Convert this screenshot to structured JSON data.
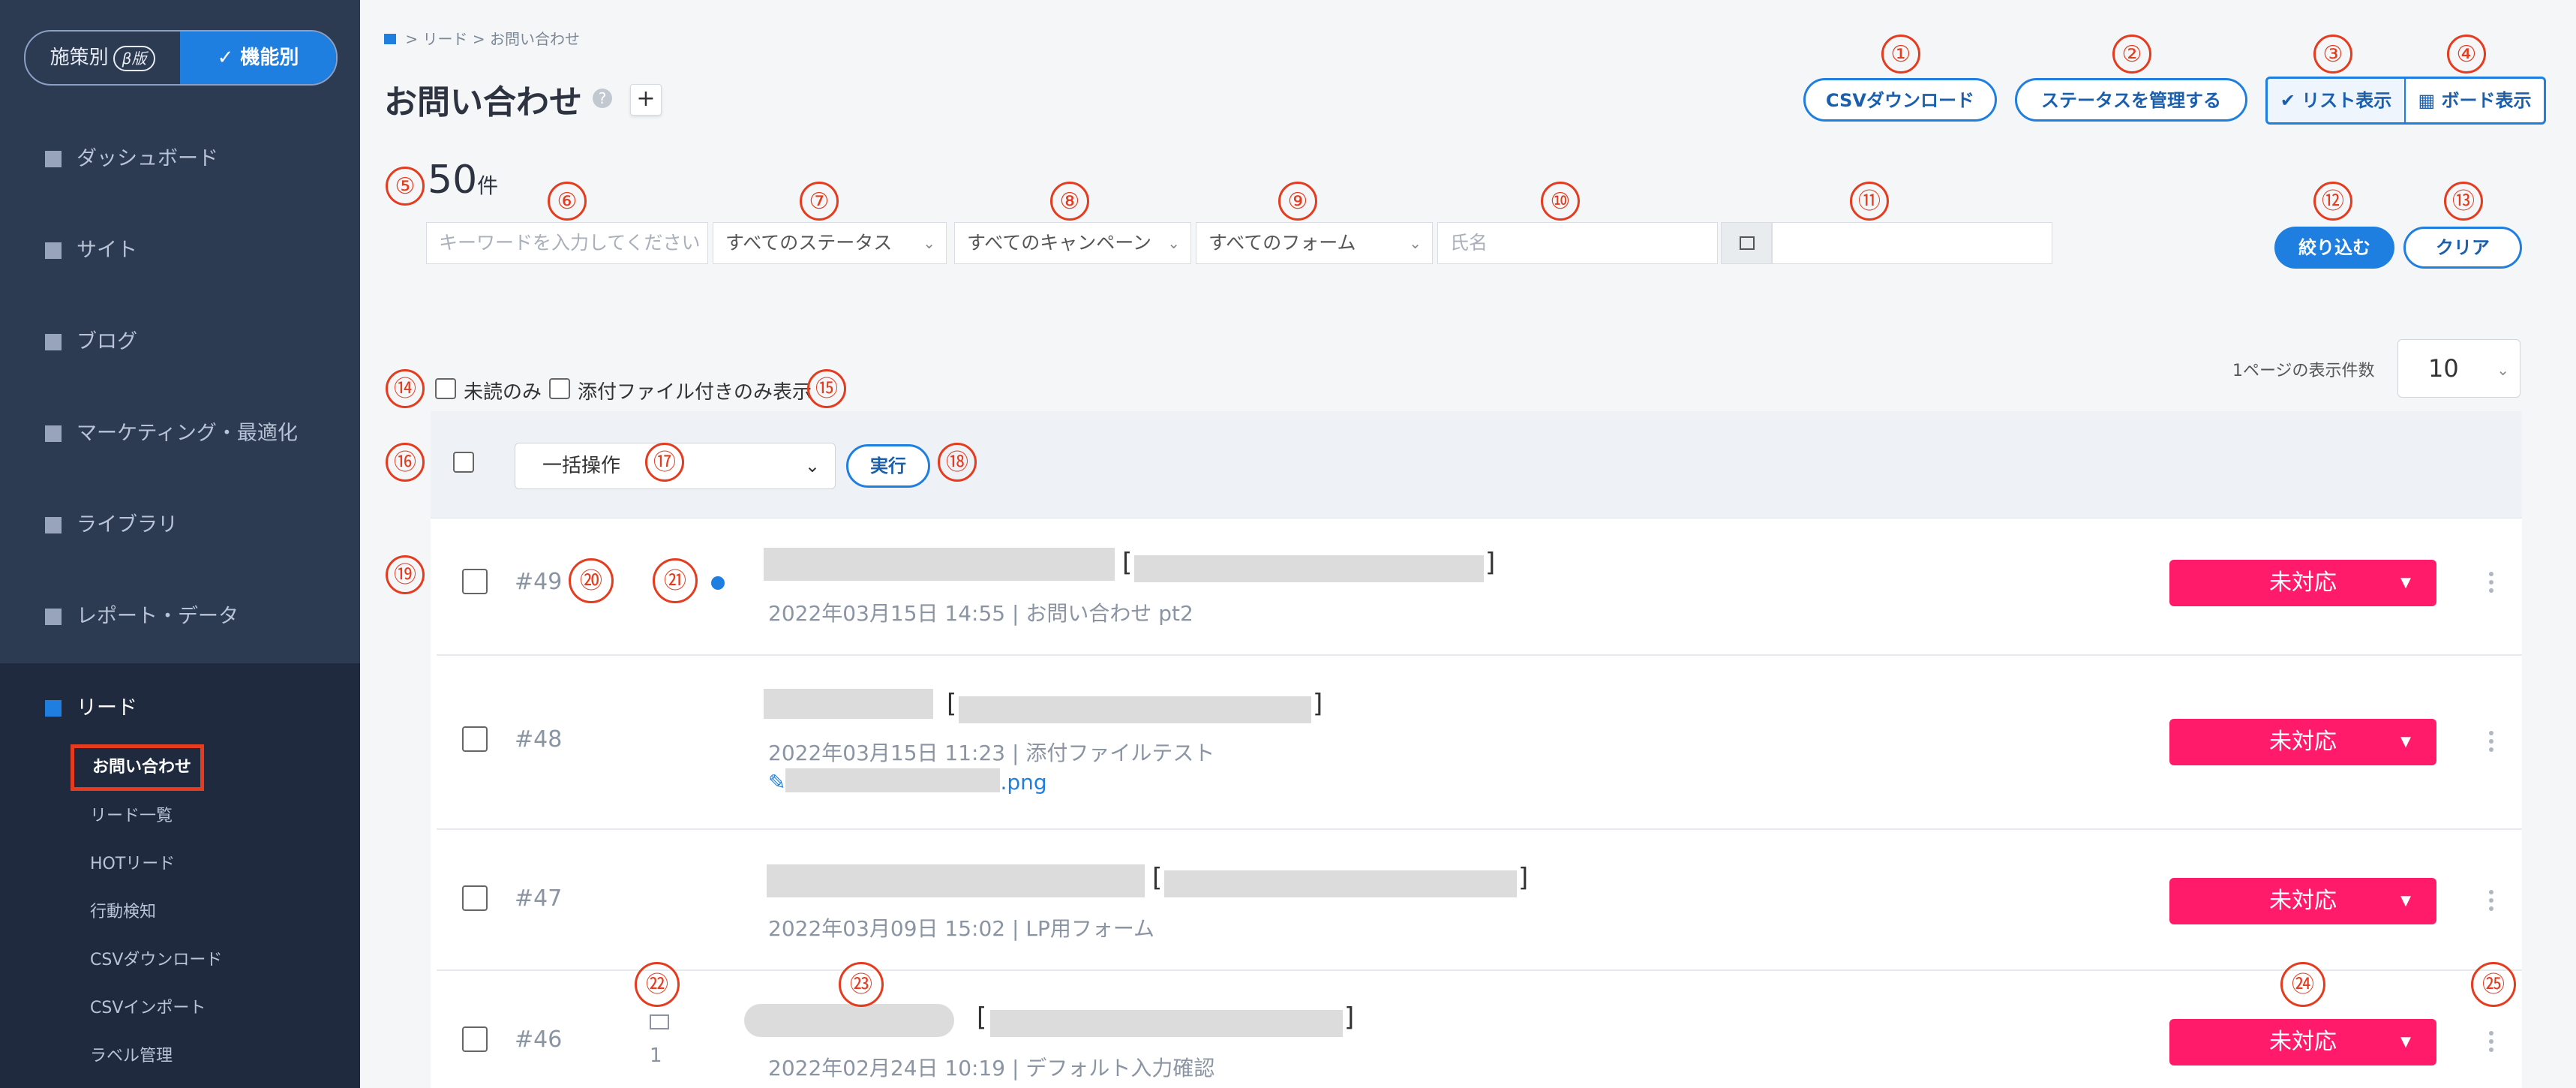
{
  "sidebar": {
    "toggle": {
      "left": "施策別",
      "beta": "β版",
      "right": "✓  機能別"
    },
    "items": [
      {
        "label": "ダッシュボード"
      },
      {
        "label": "サイト"
      },
      {
        "label": "ブログ"
      },
      {
        "label": "マーケティング・最適化"
      },
      {
        "label": "ライブラリ"
      },
      {
        "label": "レポート・データ"
      },
      {
        "label": "リード"
      }
    ],
    "lead_sub": [
      "お問い合わせ",
      "リード一覧",
      "HOTリード",
      "行動検知",
      "CSVダウンロード",
      "CSVインポート",
      "ラベル管理"
    ]
  },
  "breadcrumb": {
    "sep1": ">",
    "level1": "リード",
    "sep2": ">",
    "current": "お問い合わせ"
  },
  "header": {
    "title": "お問い合わせ",
    "help": "?",
    "add": "+",
    "csv_button": "CSVダウンロード",
    "status_button": "ステータスを管理する",
    "list_view": "✔ リスト表示",
    "board_view": "ボード表示"
  },
  "filters": {
    "count": "50",
    "count_unit": "件",
    "keyword_placeholder": "キーワードを入力してください",
    "status": "すべてのステータス",
    "campaign": "すべてのキャンペーン",
    "form": "すべてのフォーム",
    "name_placeholder": "氏名",
    "apply": "絞り込む",
    "clear": "クリア",
    "unread_only": "未読のみ",
    "attach_only": "添付ファイル付きのみ表示",
    "per_page_label": "1ページの表示件数",
    "per_page": "10"
  },
  "bulk": {
    "select": "一括操作",
    "run": "実行"
  },
  "rows": [
    {
      "id": "#49",
      "meta": "2022年03月15日 14:55 | お問い合わせ pt2",
      "status": "未対応"
    },
    {
      "id": "#48",
      "meta": "2022年03月15日 11:23 | 添付ファイルテスト",
      "attachment": ".png",
      "status": "未対応"
    },
    {
      "id": "#47",
      "meta": "2022年03月09日 15:02 | LP用フォーム",
      "status": "未対応"
    },
    {
      "id": "#46",
      "meta": "2022年02月24日 10:19 | デフォルト入力確認",
      "mail_count": "1",
      "status": "未対応"
    }
  ],
  "markers": [
    "①",
    "②",
    "③",
    "④",
    "⑤",
    "⑥",
    "⑦",
    "⑧",
    "⑨",
    "⑩",
    "⑪",
    "⑫",
    "⑬",
    "⑭",
    "⑮",
    "⑯",
    "⑰",
    "⑱",
    "⑲",
    "⑳",
    "㉑",
    "㉒",
    "㉓",
    "㉔",
    "㉕"
  ]
}
